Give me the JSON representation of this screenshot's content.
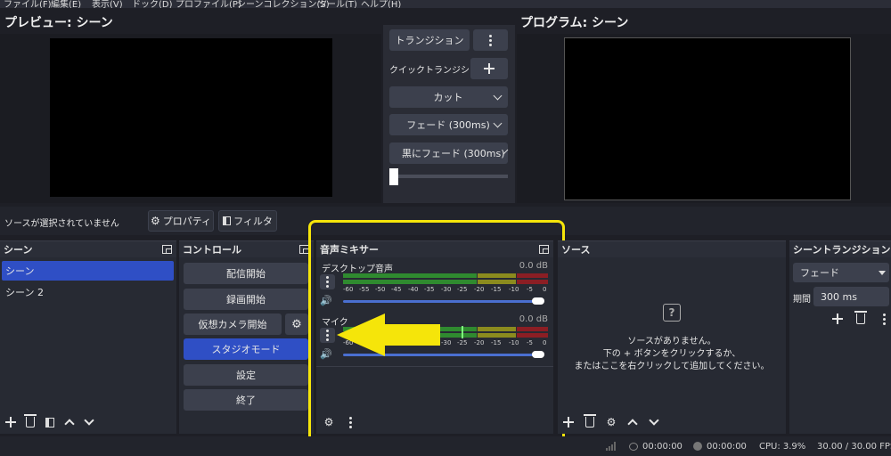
{
  "menu": [
    "ファイル(F)",
    "編集(E)",
    "表示(V)",
    "ドック(D)",
    "プロファイル(P)",
    "シーンコレクション(S)",
    "ツール(T)",
    "ヘルプ(H)"
  ],
  "preview": {
    "title": "プレビュー: シーン"
  },
  "program": {
    "title": "プログラム: シーン"
  },
  "transition": {
    "button": "トランジション",
    "quick_label": "クイックトランジション",
    "cut": "カット",
    "fade": "フェード (300ms)",
    "fade_black": "黒にフェード (300ms)"
  },
  "source_toolbar": {
    "status": "ソースが選択されていません",
    "properties": "プロパティ",
    "filters": "フィルタ"
  },
  "scenes": {
    "title": "シーン",
    "items": [
      "シーン",
      "シーン 2"
    ]
  },
  "controls": {
    "title": "コントロール",
    "buttons": [
      "配信開始",
      "録画開始",
      "仮想カメラ開始",
      "スタジオモード",
      "設定",
      "終了"
    ]
  },
  "mixer": {
    "title": "音声ミキサー",
    "scale": [
      "-60",
      "-55",
      "-50",
      "-45",
      "-40",
      "-35",
      "-30",
      "-25",
      "-20",
      "-15",
      "-10",
      "-5",
      "0"
    ],
    "channels": [
      {
        "name": "デスクトップ音声",
        "db": "0.0 dB",
        "volume": 1.0
      },
      {
        "name": "マイク",
        "db": "0.0 dB",
        "volume": 1.0
      }
    ]
  },
  "sources": {
    "title": "ソース",
    "empty_1": "ソースがありません。",
    "empty_2": "下の + ボタンをクリックするか、",
    "empty_3": "またはここを右クリックして追加してください。"
  },
  "scene_transitions": {
    "title": "シーントランジション",
    "type": "フェード",
    "duration_label": "期間",
    "duration": "300 ms"
  },
  "status": {
    "live_time": "00:00:00",
    "rec_time": "00:00:00",
    "cpu": "CPU: 3.9%",
    "fps": "30.00 / 30.00 FPS"
  },
  "colors": {
    "highlight": "#f5e50a",
    "accent": "#2f4fc5",
    "meter_green": "#2f8a2f",
    "meter_yellow": "#8b8b1e",
    "meter_red": "#8b1e24"
  }
}
